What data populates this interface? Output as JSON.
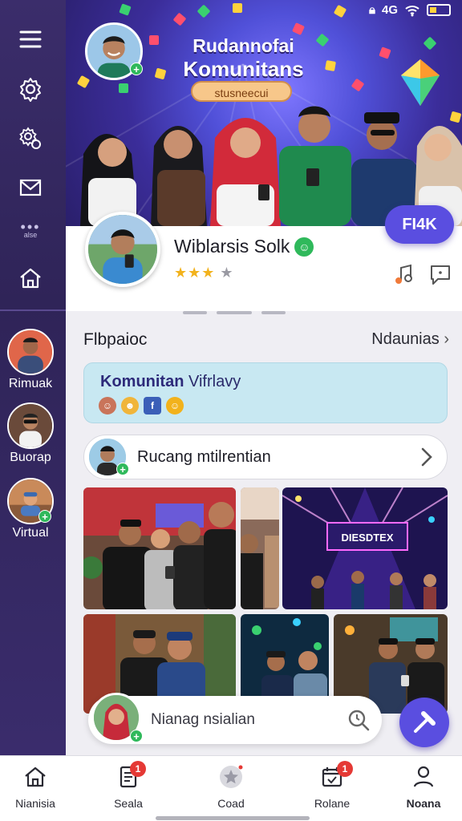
{
  "status_bar": {
    "icons": [
      "lock-icon",
      "signal-icon",
      "wifi-icon",
      "battery-icon"
    ],
    "network": "4G"
  },
  "sidebar": {
    "items": [
      {
        "icon": "menu-icon"
      },
      {
        "icon": "gear-icon"
      },
      {
        "icon": "settings-cog-icon"
      },
      {
        "icon": "mail-icon"
      },
      {
        "icon": "more-icon",
        "label": "alse"
      },
      {
        "icon": "home-icon"
      }
    ],
    "contacts": [
      {
        "label": "Rimuak"
      },
      {
        "label": "Buorap"
      },
      {
        "label": "Virtual"
      }
    ]
  },
  "hero": {
    "title_line1": "Rudannofai",
    "title_line2": "Komunitans",
    "pill": "stusneecui"
  },
  "profile": {
    "name": "Wiblarsis Solk",
    "rating": 3,
    "rating_max": 4,
    "fab_label": "FI4K"
  },
  "section": {
    "title": "Flbpaioc",
    "link": "Ndaunias"
  },
  "community_card": {
    "title_bold": "Komunitan",
    "title_rest": " Vifrlavy"
  },
  "search_row": {
    "text": "Rucang mtilrentian"
  },
  "photos": {
    "event_sign": "DIESDTEX"
  },
  "bottom_input": {
    "placeholder": "Nianag nsialian"
  },
  "bottom_nav": [
    {
      "label": "Nianisia",
      "icon": "home-icon"
    },
    {
      "label": "Seala",
      "icon": "document-icon",
      "badge": "1"
    },
    {
      "label": "Coad",
      "icon": "star-icon"
    },
    {
      "label": "Rolane",
      "icon": "calendar-icon",
      "badge": "1"
    },
    {
      "label": "Noana",
      "icon": "profile-icon"
    }
  ],
  "colors": {
    "accent": "#5a4ee0",
    "sidebar": "#3b2d6b",
    "success": "#2fb95b",
    "badge": "#e53935",
    "card": "#c8e8f2"
  }
}
